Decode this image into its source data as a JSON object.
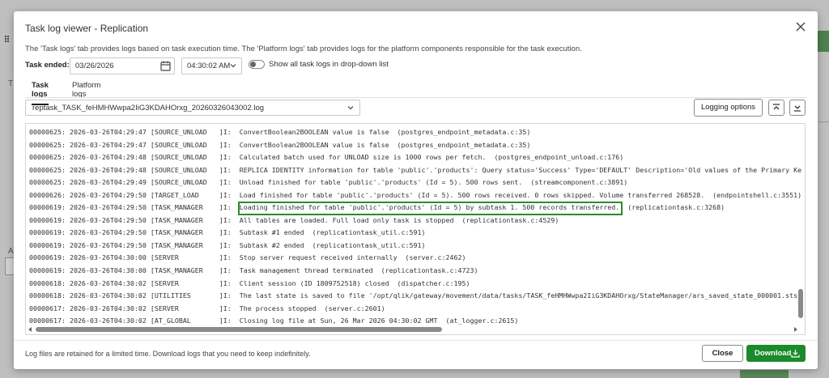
{
  "dialog": {
    "title": "Task log viewer - Replication",
    "description": "The 'Task logs' tab provides logs based on task execution time. The 'Platform logs' tab provides logs for the platform components responsible for the task execution."
  },
  "controls": {
    "task_ended_label": "Task ended:",
    "date_value": "03/26/2026",
    "time_value": "04:30:02 AM",
    "show_all_label": "Show all task logs in drop-down list",
    "show_all_enabled": false
  },
  "tabs": [
    {
      "label": "Task logs",
      "active": true
    },
    {
      "label": "Platform logs",
      "active": false
    }
  ],
  "file_select": {
    "value": "reptask_TASK_feHMHWwpa2IiG3KDAHOrxg_20260326043002.log"
  },
  "toolbar": {
    "logging_options_label": "Logging options"
  },
  "log_lines": [
    "00000625: 2026-03-26T04:29:47 [SOURCE_UNLOAD   ]I:  ConvertBoolean2BOOLEAN value is false  (postgres_endpoint_metadata.c:35)",
    "00000625: 2026-03-26T04:29:47 [SOURCE_UNLOAD   ]I:  ConvertBoolean2BOOLEAN value is false  (postgres_endpoint_metadata.c:35)",
    "00000625: 2026-03-26T04:29:48 [SOURCE_UNLOAD   ]I:  Calculated batch used for UNLOAD size is 1000 rows per fetch.  (postgres_endpoint_unload.c:176)",
    "00000625: 2026-03-26T04:29:48 [SOURCE_UNLOAD   ]I:  REPLICA IDENTITY information for table 'public'.'products': Query status='Success' Type='DEFAULT' Description='Old values of the Primary Ke",
    "00000625: 2026-03-26T04:29:49 [SOURCE_UNLOAD   ]I:  Unload finished for table 'public'.'products' (Id = 5). 500 rows sent.  (streamcomponent.c:3891)",
    "00000626: 2026-03-26T04:29:50 [TARGET_LOAD     ]I:  Load finished for table 'public'.'products' (Id = 5). 500 rows received. 0 rows skipped. Volume transferred 268528.  (endpointshell.c:3551)",
    "00000619: 2026-03-26T04:29:50 [TASK_MANAGER    ]I:  Loading finished for table 'public'.'products' (Id = 5) by subtask 1. 500 records transferred.  (replicationtask.c:3268)",
    "00000619: 2026-03-26T04:29:50 [TASK_MANAGER    ]I:  All tables are loaded. Full load only task is stopped  (replicationtask.c:4529)",
    "00000619: 2026-03-26T04:29:50 [TASK_MANAGER    ]I:  Subtask #1 ended  (replicationtask_util.c:591)",
    "00000619: 2026-03-26T04:29:50 [TASK_MANAGER    ]I:  Subtask #2 ended  (replicationtask_util.c:591)",
    "00000619: 2026-03-26T04:30:00 [SERVER          ]I:  Stop server request received internally  (server.c:2462)",
    "00000619: 2026-03-26T04:30:00 [TASK_MANAGER    ]I:  Task management thread terminated  (replicationtask.c:4723)",
    "00000618: 2026-03-26T04:30:02 [SERVER          ]I:  Client session (ID 1809752518) closed  (dispatcher.c:195)",
    "00000618: 2026-03-26T04:30:02 [UTILITIES       ]I:  The last state is saved to file '/opt/qlik/gateway/movement/data/tasks/TASK_feHMHWwpa2IiG3KDAHOrxg/StateManager/ars_saved_state_000001.sts'",
    "00000617: 2026-03-26T04:30:02 [SERVER          ]I:  The process stopped  (server.c:2601)",
    "00000617: 2026-03-26T04:30:02 [AT_GLOBAL       ]I:  Closing log file at Sun, 26 Mar 2026 04:30:02 GMT  (at_logger.c:2615)"
  ],
  "footer": {
    "note": "Log files are retained for a limited time. Download logs that you need to keep indefinitely.",
    "close_label": "Close",
    "download_label": "Download"
  },
  "colors": {
    "primary_green": "#1a8a2a",
    "highlight_border": "#2d8a2d"
  }
}
